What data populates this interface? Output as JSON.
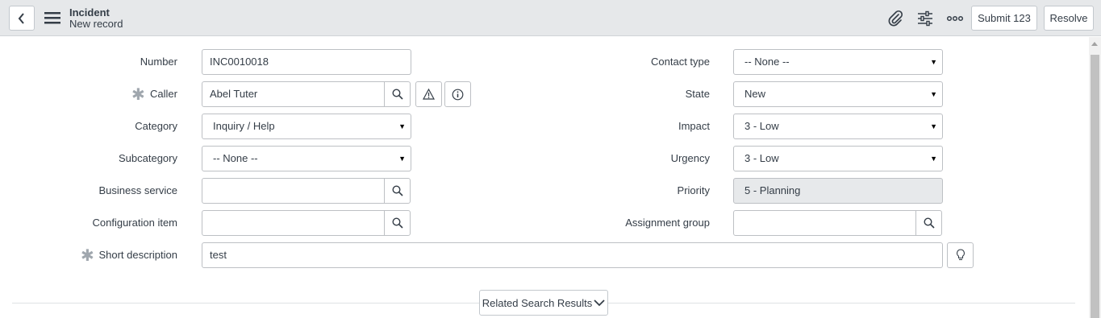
{
  "header": {
    "title": "Incident",
    "subtitle": "New record",
    "submit_label": "Submit 123",
    "resolve_label": "Resolve",
    "icons": [
      "back-icon",
      "menu-icon",
      "paperclip-icon",
      "settings-sliders-icon",
      "more-options-icon"
    ]
  },
  "form": {
    "number": {
      "label": "Number",
      "value": "INC0010018"
    },
    "caller": {
      "label": "Caller",
      "value": "Abel Tuter",
      "mandatory": "✱"
    },
    "category": {
      "label": "Category",
      "value": "Inquiry / Help"
    },
    "subcategory": {
      "label": "Subcategory",
      "value": "-- None --"
    },
    "business_service": {
      "label": "Business service",
      "value": ""
    },
    "configuration_item": {
      "label": "Configuration item",
      "value": ""
    },
    "short_description": {
      "label": "Short description",
      "value": "test",
      "mandatory": "✱"
    },
    "contact_type": {
      "label": "Contact type",
      "value": "-- None --"
    },
    "state": {
      "label": "State",
      "value": "New"
    },
    "impact": {
      "label": "Impact",
      "value": "3 - Low"
    },
    "urgency": {
      "label": "Urgency",
      "value": "3 - Low"
    },
    "priority": {
      "label": "Priority",
      "value": "5 - Planning"
    },
    "assignment_group": {
      "label": "Assignment group",
      "value": ""
    }
  },
  "related": {
    "label": "Related Search Results"
  },
  "colors": {
    "header_bg": "#e6e8ea",
    "readonly_bg": "#e7e9eb",
    "border": "#bdc0c4",
    "text": "#343d47"
  }
}
